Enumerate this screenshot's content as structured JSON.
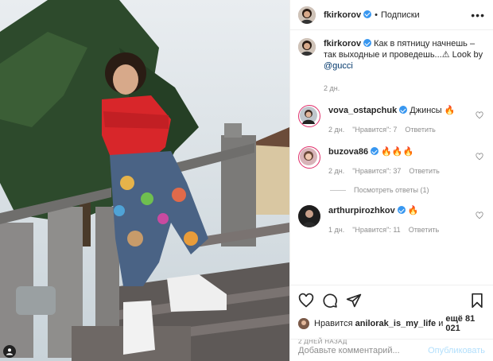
{
  "header": {
    "username": "fkirkorov",
    "dot": "•",
    "follow_label": "Подписки",
    "more": "•••"
  },
  "caption": {
    "username": "fkirkorov",
    "text": "Как в пятницу начнешь – так выходные и проведешь...⚠ Look by ",
    "mention": "@gucci",
    "time": "2 дн."
  },
  "comments": [
    {
      "username": "vova_ostapchuk",
      "text": "Джинсы 🔥",
      "time": "2 дн.",
      "likes": "\"Нравится\": 7",
      "reply": "Ответить"
    },
    {
      "username": "buzova86",
      "text": "🔥🔥🔥",
      "time": "2 дн.",
      "likes": "\"Нравится\": 37",
      "reply": "Ответить",
      "view_replies": "Посмотреть ответы (1)"
    },
    {
      "username": "arthurpirozhkov",
      "text": "🔥",
      "time": "1 дн.",
      "likes": "\"Нравится\": 11",
      "reply": "Ответить"
    }
  ],
  "likes": {
    "prefix": "Нравится",
    "user": "anilorak_is_my_life",
    "middle": "и",
    "count": "ещё 81 021"
  },
  "date": "2 ДНЕЙ НАЗАД",
  "add_comment": {
    "placeholder": "Добавьте комментарий...",
    "publish": "Опубликовать"
  },
  "colors": {
    "verified": "#3897f0",
    "publish_disabled": "#b2dffc",
    "sweater": "#d8262a"
  },
  "icons": [
    "heart-icon",
    "comment-icon",
    "share-icon",
    "bookmark-icon",
    "user-tag-icon"
  ]
}
